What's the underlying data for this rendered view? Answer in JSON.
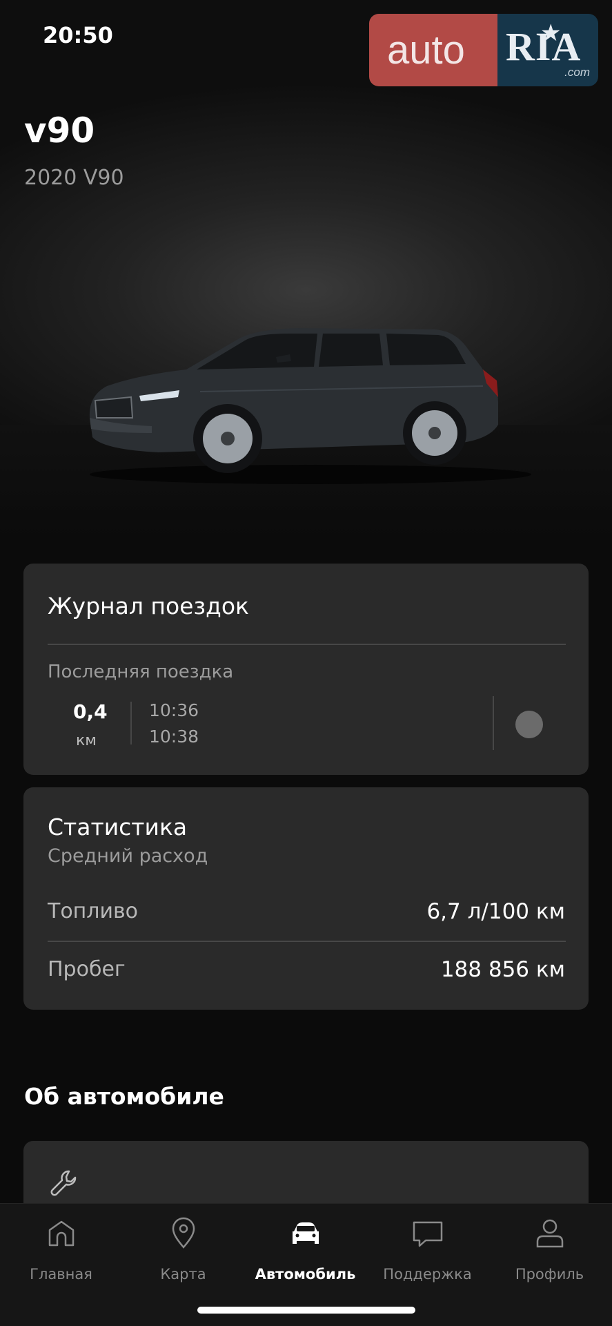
{
  "status_bar": {
    "time": "20:50"
  },
  "watermark": {
    "part1": "auto",
    "part2": "RIA",
    "domain": ".com"
  },
  "vehicle": {
    "name": "v90",
    "model": "2020 V90"
  },
  "trip_log": {
    "title": "Журнал поездок",
    "last_trip_label": "Последняя поездка",
    "distance": "0,4",
    "distance_unit": "км",
    "start_time": "10:36",
    "end_time": "10:38"
  },
  "statistics": {
    "title": "Статистика",
    "subtitle": "Средний расход",
    "fuel_label": "Топливо",
    "fuel_value": "6,7 л/100 км",
    "mileage_label": "Пробег",
    "mileage_value": "188 856 км"
  },
  "about": {
    "title": "Об автомобиле",
    "icon": "wrench-icon"
  },
  "tabbar": {
    "items": [
      {
        "label": "Главная",
        "icon": "home-icon"
      },
      {
        "label": "Карта",
        "icon": "map-pin-icon"
      },
      {
        "label": "Автомобиль",
        "icon": "car-icon",
        "active": true
      },
      {
        "label": "Поддержка",
        "icon": "chat-icon"
      },
      {
        "label": "Профиль",
        "icon": "profile-icon"
      }
    ]
  },
  "colors": {
    "background": "#0b0b0b",
    "card": "#2a2a2a",
    "muted_text": "#9c9c9c",
    "watermark_red": "#b24a46",
    "watermark_blue": "#16364a"
  }
}
